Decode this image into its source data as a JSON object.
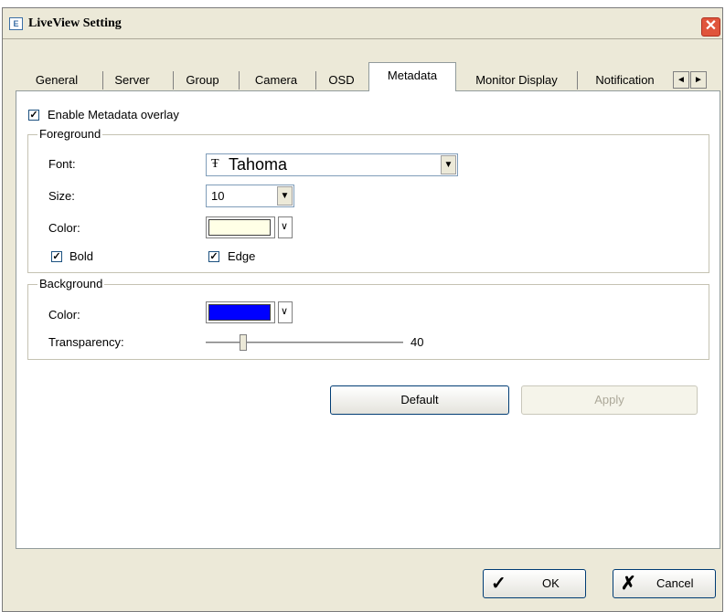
{
  "window": {
    "title": "LiveView Setting",
    "icon": "settings-icon",
    "close_symbol": "✕"
  },
  "tabs": [
    {
      "label": "General"
    },
    {
      "label": "Server"
    },
    {
      "label": "Group"
    },
    {
      "label": "Camera"
    },
    {
      "label": "OSD"
    },
    {
      "label": "Metadata",
      "active": true
    },
    {
      "label": "Monitor Display"
    },
    {
      "label": "Notification"
    }
  ],
  "tab_scroll": {
    "left": "◄",
    "right": "►"
  },
  "metadata": {
    "enable_overlay": {
      "label": "Enable Metadata overlay",
      "checked": true
    },
    "foreground": {
      "title": "Foreground",
      "font_label": "Font:",
      "font_value": "Tahoma",
      "font_glyph": "Ŧ",
      "size_label": "Size:",
      "size_value": "10",
      "color_label": "Color:",
      "color_value": "#ffffe6",
      "bold": {
        "label": "Bold",
        "checked": true
      },
      "edge": {
        "label": "Edge",
        "checked": true
      }
    },
    "background": {
      "title": "Background",
      "color_label": "Color:",
      "color_value": "#0000ff",
      "transparency_label": "Transparency:",
      "transparency_value": "40",
      "transparency_fraction": 0.18
    }
  },
  "buttons": {
    "default": "Default",
    "apply": "Apply",
    "ok": "OK",
    "cancel": "Cancel"
  },
  "check_mark": "✓",
  "checkbox_mark": "✓",
  "cancel_mark": "✗"
}
